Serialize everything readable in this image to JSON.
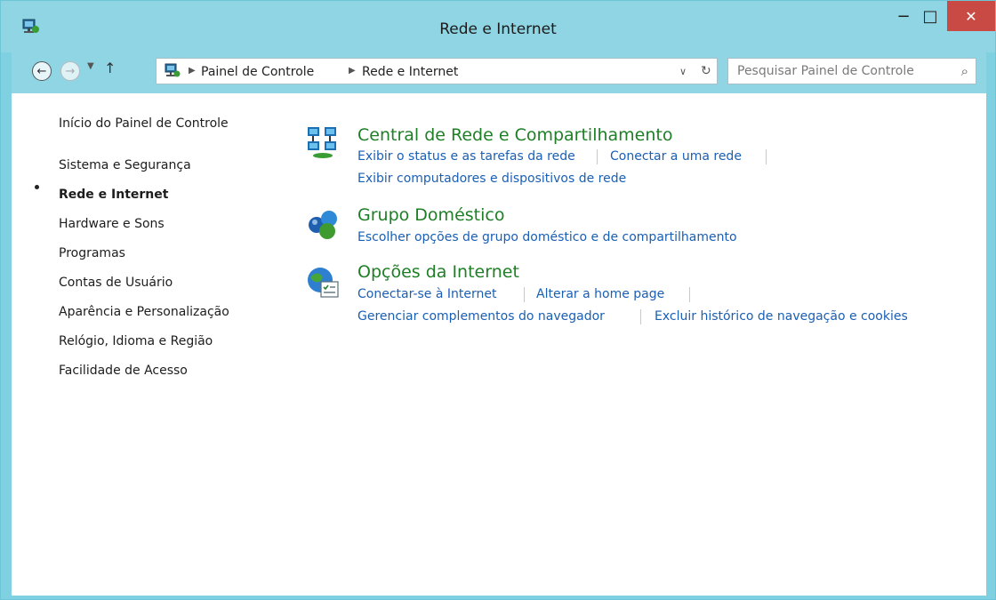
{
  "window": {
    "title": "Rede e Internet",
    "controls": {
      "minimize": "−",
      "maximize": "□",
      "close": "✕"
    }
  },
  "toolbar": {
    "back_icon": "arrow-left-icon",
    "forward_icon": "arrow-right-icon",
    "up_icon": "arrow-up-icon"
  },
  "address": {
    "crumbs": [
      "Painel de Controle",
      "Rede e Internet"
    ],
    "separator": "▶"
  },
  "search": {
    "placeholder": "Pesquisar Painel de Controle",
    "icon": "search-icon"
  },
  "sidebar": {
    "items": [
      {
        "label": "Início do Painel de Controle"
      },
      {
        "label": "Sistema e Segurança"
      },
      {
        "label": "Rede e Internet",
        "active": true
      },
      {
        "label": "Hardware e Sons"
      },
      {
        "label": "Programas"
      },
      {
        "label": "Contas de Usuário"
      },
      {
        "label": "Aparência e Personalização"
      },
      {
        "label": "Relógio, Idioma e Região"
      },
      {
        "label": "Facilidade de Acesso"
      }
    ]
  },
  "categories": [
    {
      "title": "Central de Rede e Compartilhamento",
      "icon": "network-center-icon",
      "links": [
        "Exibir o status e as tarefas da rede",
        "Conectar a uma rede",
        "Exibir computadores e dispositivos de rede"
      ]
    },
    {
      "title": "Grupo Doméstico",
      "icon": "homegroup-icon",
      "links": [
        "Escolher opções de grupo doméstico e de compartilhamento"
      ]
    },
    {
      "title": "Opções da Internet",
      "icon": "internet-options-icon",
      "links": [
        "Conectar-se à Internet",
        "Alterar a home page",
        "Gerenciar complementos do navegador",
        "Excluir histórico de navegação e cookies"
      ]
    }
  ],
  "colors": {
    "accent": "#8fd5e3",
    "category_title": "#1e7f26",
    "link": "#1a5fb4",
    "close": "#c94a44"
  }
}
